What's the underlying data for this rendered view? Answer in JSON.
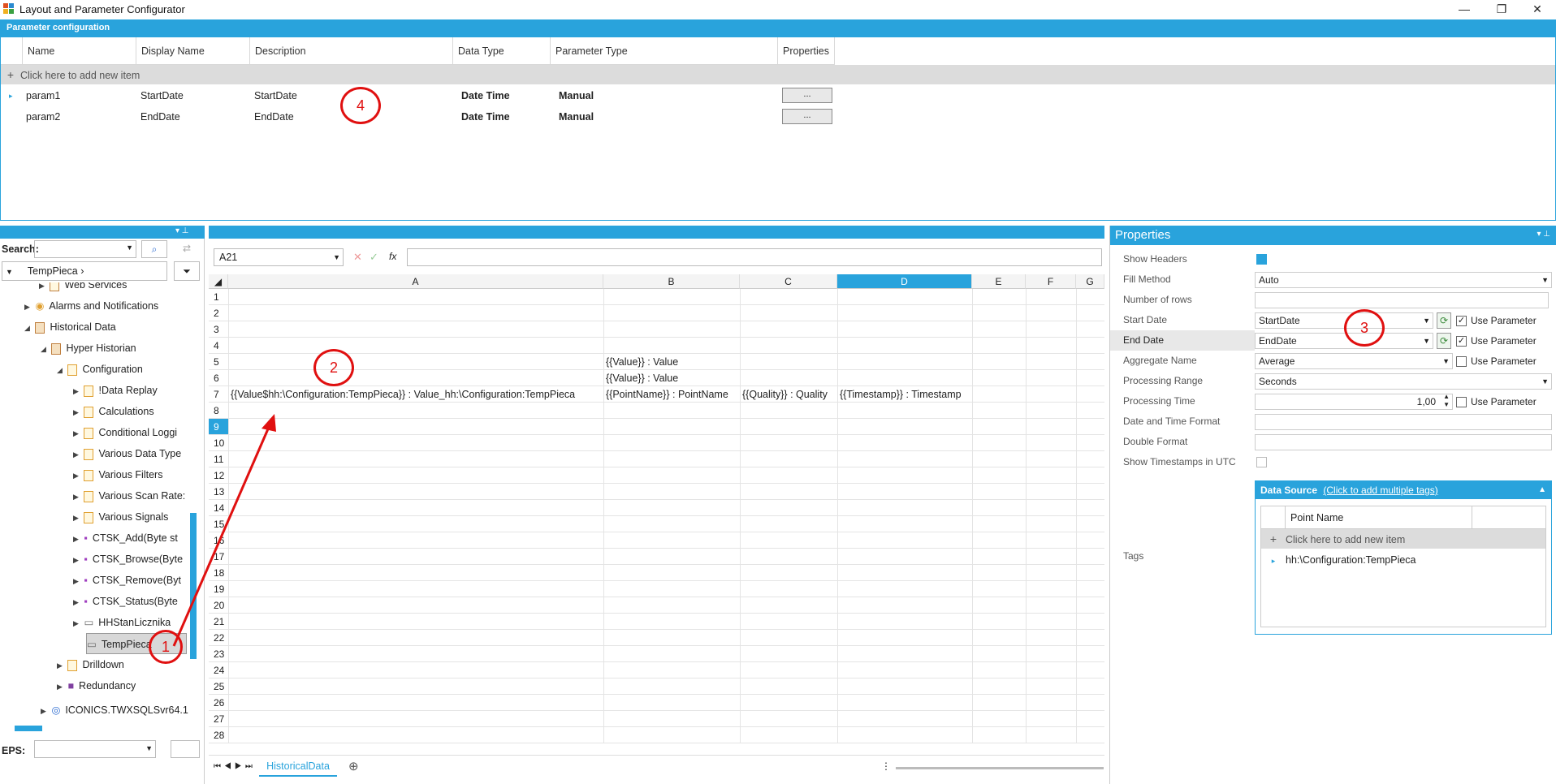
{
  "window": {
    "title": "Layout and Parameter Configurator",
    "minimize": "—",
    "restore": "❐",
    "close": "✕"
  },
  "param_panel": {
    "header": "Parameter configuration",
    "columns": [
      "Name",
      "Display Name",
      "Description",
      "Data Type",
      "Parameter Type",
      "Properties"
    ],
    "add_row": "Click here to add new item",
    "rows": [
      {
        "name": "param1",
        "display": "StartDate",
        "desc": "StartDate",
        "dtype": "Date Time",
        "ptype": "Manual",
        "btn": "..."
      },
      {
        "name": "param2",
        "display": "EndDate",
        "desc": "EndDate",
        "dtype": "Date Time",
        "ptype": "Manual",
        "btn": "..."
      }
    ]
  },
  "annotations": {
    "a1": "1",
    "a2": "2",
    "a3": "3",
    "a4": "4"
  },
  "left": {
    "search_label": "Search:",
    "root": "TempPieca",
    "eps_label": "EPS:",
    "tree": [
      "Web Services",
      "Alarms and Notifications",
      "Historical Data",
      "Hyper Historian",
      "Configuration",
      "!Data Replay",
      "Calculations",
      "Conditional Loggi",
      "Various Data Type",
      "Various Filters",
      "Various Scan Rate:",
      "Various Signals",
      "CTSK_Add(Byte st",
      "CTSK_Browse(Byte",
      "CTSK_Remove(Byt",
      "CTSK_Status(Byte",
      "HHStanLicznika",
      "TempPieca",
      "Drilldown",
      "Redundancy",
      "ICONICS.TWXSQLSvr64.1"
    ]
  },
  "sheet": {
    "namebox": "A21",
    "fx": "fx",
    "columns": [
      "A",
      "B",
      "C",
      "D",
      "E",
      "F",
      "G"
    ],
    "rows": [
      "1",
      "2",
      "3",
      "4",
      "5",
      "6",
      "7",
      "8",
      "9",
      "10",
      "11",
      "12",
      "13",
      "14",
      "15",
      "16",
      "17",
      "18",
      "19",
      "20",
      "21",
      "22",
      "23",
      "24",
      "25",
      "26",
      "27",
      "28"
    ],
    "cells": {
      "b5": "{{Value}} : Value",
      "b6": "{{Value}} : Value",
      "a7": "{{Value$hh:\\Configuration:TempPieca}} : Value_hh:\\Configuration:TempPieca",
      "b7": "{{PointName}} : PointName",
      "c7": "{{Quality}} : Quality",
      "d7": "{{Timestamp}} : Timestamp"
    },
    "tab": "HistoricalData"
  },
  "properties": {
    "header": "Properties",
    "labels": [
      "Show Headers",
      "Fill Method",
      "Number of rows",
      "Start Date",
      "End Date",
      "Aggregate Name",
      "Processing Range",
      "Processing Time",
      "Date and Time Format",
      "Double Format",
      "Show Timestamps in UTC"
    ],
    "fill_method": "Auto",
    "start_date": "StartDate",
    "end_date": "EndDate",
    "aggregate": "Average",
    "processing_range": "Seconds",
    "processing_time": "1,00",
    "use_param": "Use Parameter",
    "tags_label": "Tags",
    "datasource_title": "Data Source",
    "datasource_link": "(Click to add multiple tags)",
    "ds_column": "Point Name",
    "ds_add": "Click here to add new item",
    "ds_item": "hh:\\Configuration:TempPieca"
  }
}
